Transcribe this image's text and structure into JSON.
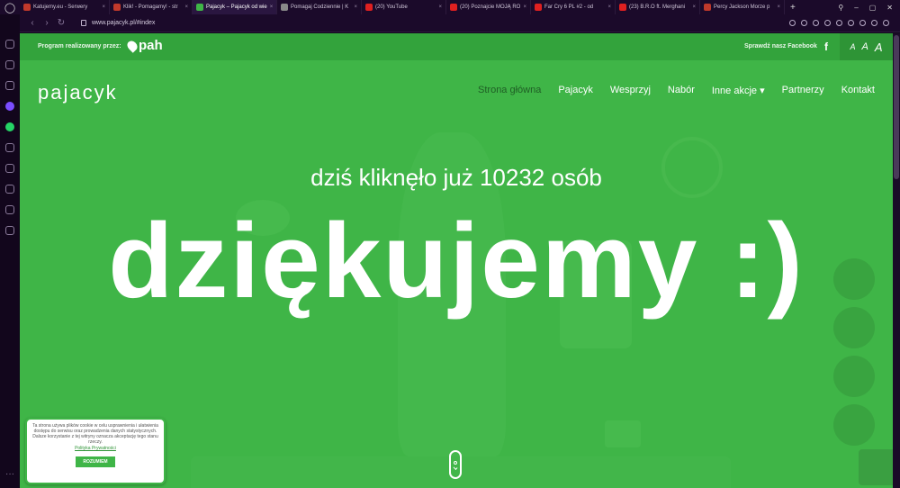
{
  "browser": {
    "tabs": [
      {
        "label": "Katujemy.eu - Serwery",
        "color": "#c0392b",
        "active": false
      },
      {
        "label": "Klik! - Pomagamy! - str",
        "color": "#c0392b",
        "active": false
      },
      {
        "label": "Pajacyk – Pajacyk od wie",
        "color": "#3fb547",
        "active": true
      },
      {
        "label": "Pomagaj Codziennie | K",
        "color": "#888888",
        "active": false
      },
      {
        "label": "(20) YouTube",
        "color": "#e02020",
        "active": false
      },
      {
        "label": "(20) Poznajcie MOJĄ RO",
        "color": "#e02020",
        "active": false
      },
      {
        "label": "Far Cry 6 PL #2 - od",
        "color": "#e02020",
        "active": false
      },
      {
        "label": "(23) B.R.O ft. Merghani",
        "color": "#e02020",
        "active": false
      },
      {
        "label": "Percy Jackson Morze p",
        "color": "#c0392b",
        "active": false
      }
    ],
    "url": "www.pajacyk.pl/#index"
  },
  "header": {
    "program_label": "Program realizowany przez:",
    "partner_logo": "pah",
    "facebook_label": "Sprawdź nasz Facebook",
    "facebook_icon": "f",
    "font_sizes": [
      "A",
      "A",
      "A"
    ]
  },
  "nav": {
    "brand": "pajacyk",
    "items": [
      "Strona główna",
      "Pajacyk",
      "Wesprzyj",
      "Nabór",
      "Inne akcje ▾",
      "Partnerzy",
      "Kontakt"
    ]
  },
  "hero": {
    "counter_text": "dziś kliknęło już 10232 osób",
    "thanks_text": "dziękujemy :)"
  },
  "cookie": {
    "text": "Ta strona używa plików cookie w celu usprawnienia i ułatwienia dostępu do serwisu oraz prowadzenia danych statystycznych. Dalsze korzystanie z tej witryny oznacza akceptację tego stanu rzeczy.",
    "link": "Polityka Prywatności",
    "button": "ROZUMIEM"
  },
  "colors": {
    "accent": "#3fb547",
    "nav_current": "#1f5e25"
  }
}
